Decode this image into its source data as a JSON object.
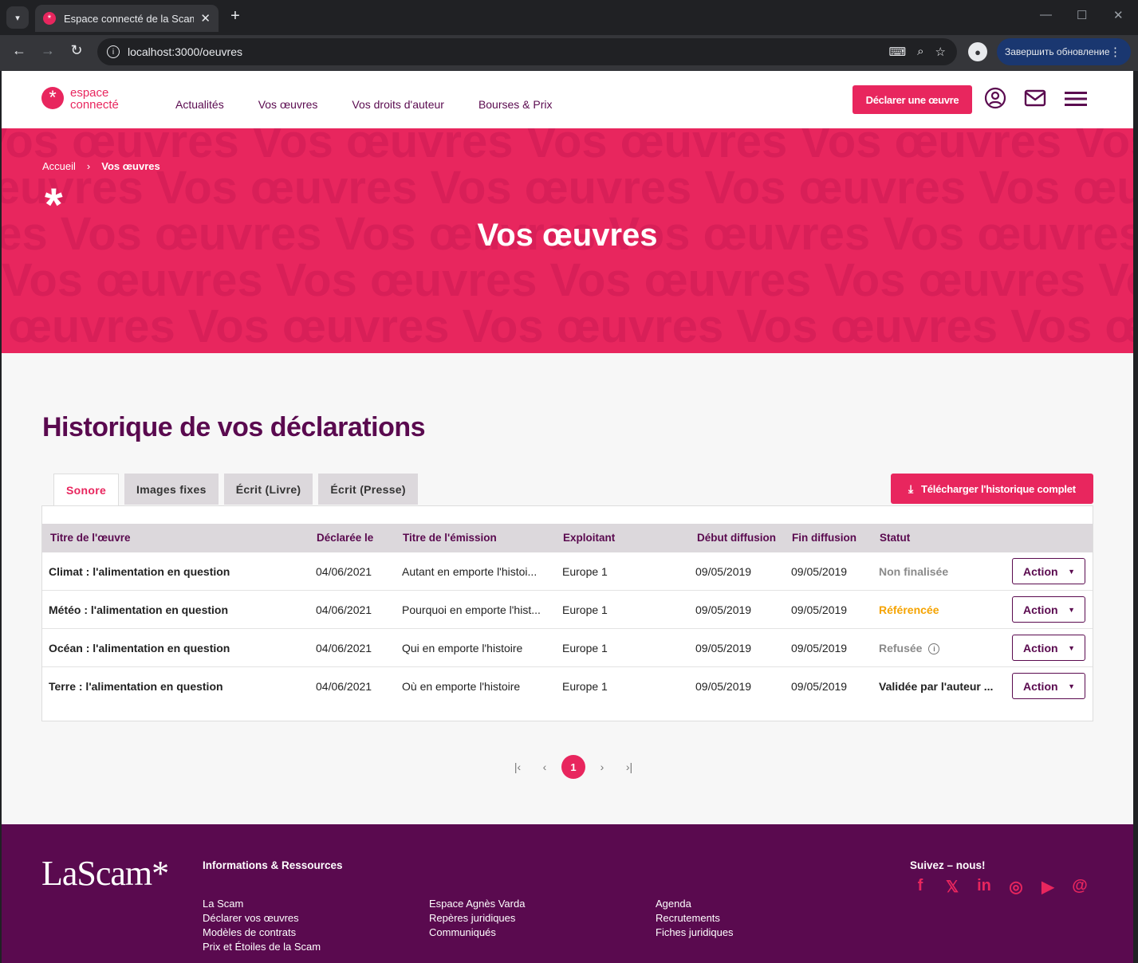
{
  "browser": {
    "tab_title": "Espace connecté de la Scam",
    "url": "localhost:3000/oeuvres",
    "update_label": "Завершить обновление"
  },
  "header": {
    "logo_line1": "espace",
    "logo_line2": "connecté",
    "nav": [
      "Actualités",
      "Vos œuvres",
      "Vos droits d'auteur",
      "Bourses & Prix"
    ],
    "declare_label": "Déclarer une œuvre"
  },
  "hero": {
    "breadcrumb_home": "Accueil",
    "breadcrumb_current": "Vos œuvres",
    "title": "Vos œuvres",
    "bg_text": "Vos œuvres Vos œuvres Vos œuvres Vos œuvres Vos œuvres"
  },
  "main": {
    "section_title": "Historique de vos déclarations",
    "tabs": [
      "Sonore",
      "Images fixes",
      "Écrit (Livre)",
      "Écrit (Presse)"
    ],
    "download_label": "Télécharger l'historique complet",
    "columns": [
      "Titre de l'œuvre",
      "Déclarée le",
      "Titre de l'émission",
      "Exploitant",
      "Début diffusion",
      "Fin diffusion",
      "Statut"
    ],
    "rows": [
      {
        "title": "Climat : l'alimentation en question",
        "declared": "04/06/2021",
        "emission": "Autant en emporte l'histoi...",
        "exploitant": "Europe 1",
        "start": "09/05/2019",
        "end": "09/05/2019",
        "status": "Non finalisée",
        "action": "Action"
      },
      {
        "title": "Météo : l'alimentation en question",
        "declared": "04/06/2021",
        "emission": "Pourquoi en emporte l'hist...",
        "exploitant": "Europe 1",
        "start": "09/05/2019",
        "end": "09/05/2019",
        "status": "Référencée",
        "action": "Action"
      },
      {
        "title": "Océan : l'alimentation en question",
        "declared": "04/06/2021",
        "emission": "Qui en emporte l'histoire",
        "exploitant": "Europe 1",
        "start": "09/05/2019",
        "end": "09/05/2019",
        "status": "Refusée",
        "action": "Action"
      },
      {
        "title": "Terre : l'alimentation en question",
        "declared": "04/06/2021",
        "emission": "Où en emporte l'histoire",
        "exploitant": "Europe 1",
        "start": "09/05/2019",
        "end": "09/05/2019",
        "status": "Validée par l'auteur ...",
        "action": "Action"
      }
    ],
    "pagination": {
      "current": "1"
    }
  },
  "footer": {
    "logo": "LaScam*",
    "heading": "Informations & Ressources",
    "col1": [
      "La Scam",
      "Déclarer vos œuvres",
      "Modèles de contrats",
      "Prix et Étoiles de la Scam"
    ],
    "col2": [
      "Espace Agnès Varda",
      "Repères juridiques",
      "Communiqués"
    ],
    "col3": [
      "Agenda",
      "Recrutements",
      "Fiches juridiques"
    ],
    "follow": "Suivez – nous!"
  },
  "colors": {
    "brand_pink": "#e8265e",
    "brand_purple": "#5a0a4f",
    "status_ref": "#f5a300"
  }
}
